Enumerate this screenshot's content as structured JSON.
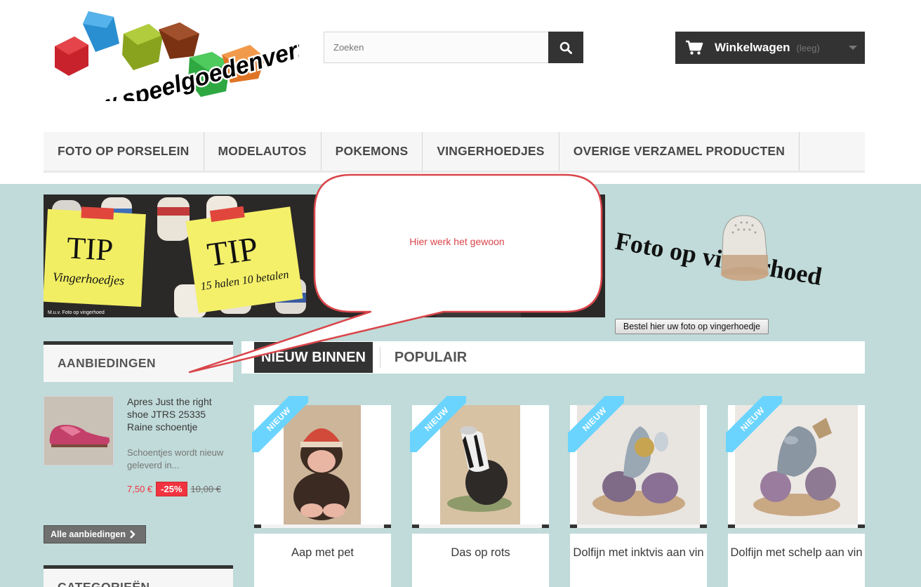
{
  "header": {
    "logo_text": "www.speelgoedenverzamel.nl",
    "search_placeholder": "Zoeken",
    "cart_label": "Winkelwagen",
    "cart_status": "(leeg)"
  },
  "nav": {
    "items": [
      {
        "label": "FOTO OP PORSELEIN"
      },
      {
        "label": "MODELAUTOS"
      },
      {
        "label": "POKEMONS"
      },
      {
        "label": "VINGERHOEDJES"
      },
      {
        "label": "OVERIGE VERZAMEL PRODUCTEN"
      }
    ]
  },
  "banner": {
    "tip1_title": "TIP",
    "tip1_sub": "Vingerhoedjes",
    "tip2_title": "TIP",
    "tip2_sub": "15 halen 10 betalen",
    "tip_footnote": "M.u.v. Foto op vingerhoed",
    "right_title": "Foto op vingerhoed",
    "order_button": "Bestel hier uw foto op vingerhoedje"
  },
  "callout": {
    "text": "Hier werk het gewoon"
  },
  "sidebar": {
    "offers_title": "AANBIEDINGEN",
    "offer": {
      "name": "Apres Just the right shoe JTRS 25335 Raine schoentje",
      "description": "Schoentjes wordt nieuw geleverd in...",
      "price": "7,50 €",
      "discount": "-25%",
      "old_price": "10,00 €"
    },
    "all_offers_label": "Alle aanbiedingen",
    "categories_title": "CATEGORIEËN"
  },
  "tabs": {
    "active": "NIEUW BINNEN",
    "inactive": "POPULAIR"
  },
  "products": [
    {
      "name": "Aap met pet",
      "badge": "NIEUW"
    },
    {
      "name": "Das op rots",
      "badge": "NIEUW"
    },
    {
      "name": "Dolfijn met inktvis aan vin",
      "badge": "NIEUW"
    },
    {
      "name": "Dolfijn met schelp aan vin",
      "badge": "NIEUW"
    }
  ],
  "colors": {
    "dark": "#333333",
    "page_bg": "#c0dbd9",
    "price_red": "#f13340",
    "ribbon_blue": "#6ad4ff",
    "callout_red": "#d9454a"
  }
}
